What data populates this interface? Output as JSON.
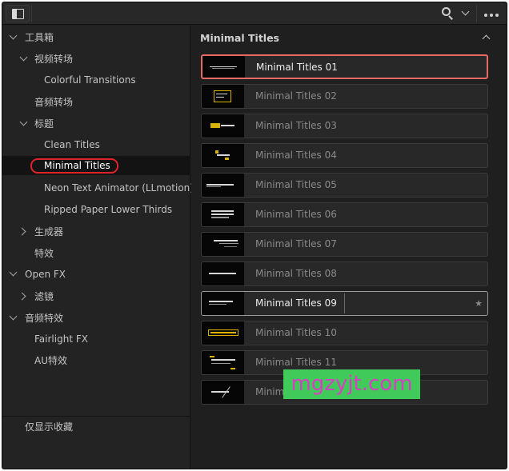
{
  "toolbar": {
    "panel_toggle_icon": "sidebar-panel-icon",
    "search_icon": "search-icon",
    "search_options_icon": "chevron-down-icon",
    "more_icon": "more-options-icon"
  },
  "sidebar": {
    "items": [
      {
        "label": "工具箱",
        "level": 0,
        "expanded": true
      },
      {
        "label": "视频转场",
        "level": 1,
        "expanded": true
      },
      {
        "label": "Colorful Transitions",
        "level": 2
      },
      {
        "label": "音频转场",
        "level": 1
      },
      {
        "label": "标题",
        "level": 1,
        "expanded": true
      },
      {
        "label": "Clean Titles",
        "level": 2
      },
      {
        "label": "Minimal Titles",
        "level": 2,
        "selected": true
      },
      {
        "label": "Neon Text Animator (LLmotion)",
        "level": 2
      },
      {
        "label": "Ripped Paper Lower Thirds",
        "level": 2
      },
      {
        "label": "生成器",
        "level": 1,
        "expanded": false
      },
      {
        "label": "特效",
        "level": 1
      },
      {
        "label": "Open FX",
        "level": 0,
        "expanded": true
      },
      {
        "label": "滤镜",
        "level": 1,
        "expanded": false
      },
      {
        "label": "音频特效",
        "level": 0,
        "expanded": true
      },
      {
        "label": "Fairlight FX",
        "level": 1
      },
      {
        "label": "AU特效",
        "level": 1
      }
    ],
    "favorites_label": "仅显示收藏",
    "highlight_color": "#e0222a"
  },
  "main": {
    "section_title": "Minimal Titles",
    "collapse_icon": "chevron-up-icon",
    "effects": [
      {
        "name": "Minimal Titles 01",
        "state": "active"
      },
      {
        "name": "Minimal Titles 02"
      },
      {
        "name": "Minimal Titles 03"
      },
      {
        "name": "Minimal Titles 04"
      },
      {
        "name": "Minimal Titles 05"
      },
      {
        "name": "Minimal Titles 06"
      },
      {
        "name": "Minimal Titles 07"
      },
      {
        "name": "Minimal Titles 08"
      },
      {
        "name": "Minimal Titles 09",
        "state": "hover",
        "favorite_icon": "★"
      },
      {
        "name": "Minimal Titles 10"
      },
      {
        "name": "Minimal Titles 11"
      },
      {
        "name": "Minimal Titles 12"
      }
    ],
    "active_border_color": "#e86a62"
  },
  "watermark": {
    "text": "mgzyjt.com",
    "background": "#3fca5a",
    "color": "#d83fc4"
  }
}
